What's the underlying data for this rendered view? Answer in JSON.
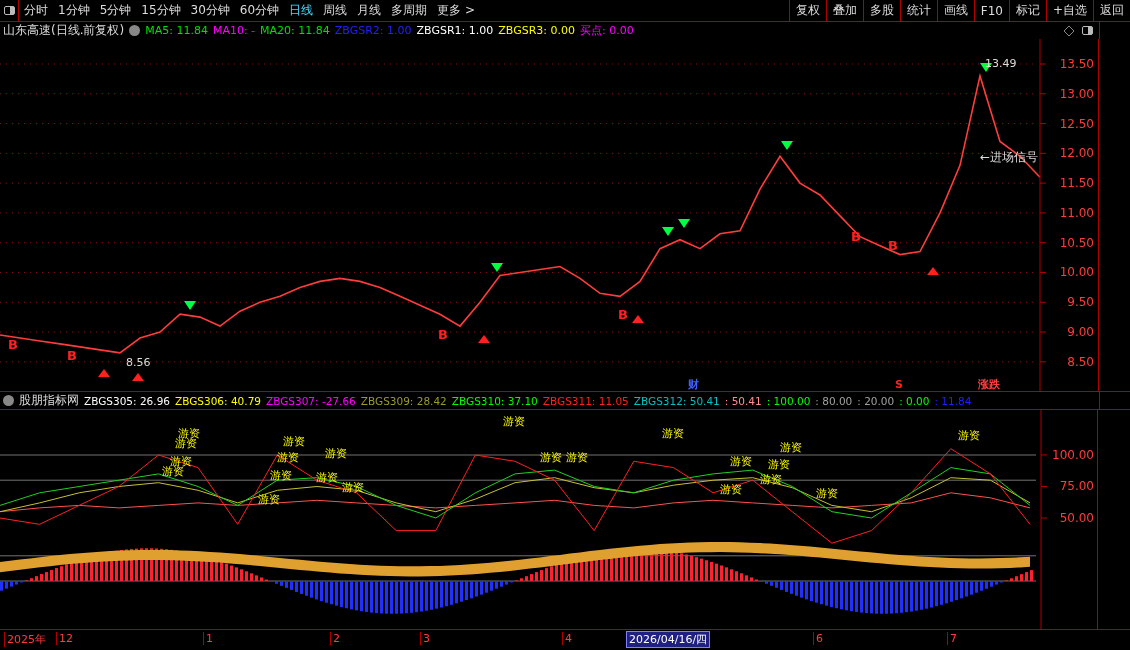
{
  "toolbar": {
    "periods": [
      {
        "label": "分时",
        "selected": false
      },
      {
        "label": "1分钟",
        "selected": false
      },
      {
        "label": "5分钟",
        "selected": false
      },
      {
        "label": "15分钟",
        "selected": false
      },
      {
        "label": "30分钟",
        "selected": false
      },
      {
        "label": "60分钟",
        "selected": false
      },
      {
        "label": "日线",
        "selected": true
      },
      {
        "label": "周线",
        "selected": false
      },
      {
        "label": "月线",
        "selected": false
      },
      {
        "label": "多周期",
        "selected": false
      },
      {
        "label": "更多 >",
        "selected": false
      }
    ],
    "buttons": [
      "复权",
      "叠加",
      "多股",
      "统计",
      "画线",
      "F10",
      "标记",
      "+自选",
      "返回"
    ]
  },
  "legend": {
    "title": "山东高速(日线.前复权)",
    "items": [
      {
        "text": "MA5: 11.84",
        "color": "#00e000"
      },
      {
        "text": "MA10: -",
        "color": "#ff00ff"
      },
      {
        "text": "MA20: 11.84",
        "color": "#00e000"
      },
      {
        "text": "ZBGSR2: 1.00",
        "color": "#2020ff"
      },
      {
        "text": "ZBGSR1: 1.00",
        "color": "#ffffff"
      },
      {
        "text": "ZBGSR3: 0.00",
        "color": "#ffff00"
      },
      {
        "text": "买点: 0.00",
        "color": "#ff00ff"
      }
    ]
  },
  "main_chart": {
    "chart_data": {
      "type": "line",
      "grid": true,
      "series": [
        {
          "color": "#ff3c3c",
          "values": [
            8.95,
            8.9,
            8.85,
            8.8,
            8.75,
            8.7,
            8.65,
            8.9,
            9.0,
            9.3,
            9.25,
            9.1,
            9.35,
            9.5,
            9.6,
            9.75,
            9.85,
            9.9,
            9.85,
            9.75,
            9.6,
            9.45,
            9.3,
            9.1,
            9.5,
            9.95,
            10.0,
            10.05,
            10.1,
            9.9,
            9.65,
            9.6,
            9.85,
            10.4,
            10.55,
            10.4,
            10.65,
            10.7,
            11.4,
            11.95,
            11.5,
            11.3,
            10.95,
            10.6,
            10.45,
            10.3,
            10.35,
            11.0,
            11.8,
            13.3,
            12.2,
            11.95,
            11.6
          ]
        }
      ],
      "ylim": [
        8.01,
        13.92
      ],
      "yticks": [
        {
          "value": 8.5,
          "label": "8.50"
        },
        {
          "value": 9,
          "label": "9.00"
        },
        {
          "value": 9.5,
          "label": "9.50"
        },
        {
          "value": 10,
          "label": "10.00"
        },
        {
          "value": 10.5,
          "label": "10.50"
        },
        {
          "value": 11,
          "label": "11.00"
        },
        {
          "value": 11.5,
          "label": "11.50"
        },
        {
          "value": 12,
          "label": "12.00"
        },
        {
          "value": 12.5,
          "label": "12.50"
        },
        {
          "value": 13,
          "label": "13.00"
        },
        {
          "value": 13.5,
          "label": "13.50"
        }
      ]
    },
    "price_labels": [
      "13.49",
      "8.56",
      "←进场信号"
    ],
    "signals": [
      "B",
      "B",
      "B",
      "B",
      "B",
      "B"
    ],
    "event_marks": [
      {
        "text": "财",
        "color": "#4060ff"
      },
      {
        "text": "S",
        "color": "#ff2020"
      },
      {
        "text": "涨跌",
        "color": "#ff4040"
      }
    ]
  },
  "indicator": {
    "title": "股朋指标网",
    "items": [
      {
        "text": "ZBGS305: 26.96",
        "color": "#ffffff"
      },
      {
        "text": "ZBGS306: 40.79",
        "color": "#ffff00"
      },
      {
        "text": "ZBGS307: -27.66",
        "color": "#ff00ff"
      },
      {
        "text": "ZBGS309: 28.42",
        "color": "#9a9a30"
      },
      {
        "text": "ZBGS310: 37.10",
        "color": "#00ff00"
      },
      {
        "text": "ZBGS311: 11.05",
        "color": "#ff2020"
      },
      {
        "text": "ZBGS312: 50.41",
        "color": "#00c0c0"
      },
      {
        "text": ": 50.41",
        "color": "#ff9090"
      },
      {
        "text": ": 100.00",
        "color": "#00ff00"
      },
      {
        "text": ": 80.00",
        "color": "#a0a0a0"
      },
      {
        "text": ": 20.00",
        "color": "#a0a0a0"
      },
      {
        "text": ": 0.00",
        "color": "#00ff00"
      },
      {
        "text": ": 11.84",
        "color": "#2020ff"
      }
    ],
    "chart_data": {
      "type": "line",
      "ylim": [
        -38.1,
        135.7
      ],
      "yticks": [
        {
          "value": 50,
          "label": "50.00"
        },
        {
          "value": 75,
          "label": "75.00"
        },
        {
          "value": 100,
          "label": "100.00"
        }
      ],
      "series": [
        {
          "color": "#ff5050",
          "values": [
            55,
            58,
            60,
            58,
            60,
            62,
            60,
            62,
            64,
            62,
            60,
            58,
            60,
            62,
            64,
            60,
            58,
            62,
            64,
            62,
            60,
            58,
            60,
            62,
            70,
            66,
            58
          ]
        },
        {
          "color": "#c8c030",
          "values": [
            55,
            62,
            70,
            75,
            78,
            72,
            62,
            72,
            75,
            72,
            62,
            55,
            65,
            78,
            82,
            74,
            70,
            76,
            80,
            82,
            74,
            60,
            55,
            66,
            82,
            80,
            62
          ]
        },
        {
          "color": "#20d020",
          "values": [
            60,
            70,
            75,
            80,
            85,
            75,
            60,
            80,
            82,
            75,
            60,
            50,
            70,
            85,
            88,
            75,
            70,
            80,
            85,
            88,
            75,
            55,
            50,
            70,
            90,
            85,
            60
          ]
        },
        {
          "color": "#ff2020",
          "values": [
            50,
            45,
            60,
            75,
            100,
            90,
            45,
            100,
            80,
            70,
            40,
            40,
            100,
            95,
            80,
            40,
            95,
            90,
            70,
            80,
            55,
            30,
            40,
            70,
            105,
            85,
            45
          ]
        }
      ]
    },
    "labels": [
      "游资",
      "游资",
      "游资",
      "游资",
      "游资",
      "游资",
      "游资",
      "游资",
      "游资",
      "游资",
      "游资",
      "游资",
      "游资",
      "游资",
      "游资",
      "游资",
      "游资",
      "游资",
      "游资",
      "游资",
      "游资",
      "游资"
    ]
  },
  "time_axis": [
    {
      "label": "2025年",
      "selected": false
    },
    {
      "label": "12",
      "selected": false
    },
    {
      "label": "1",
      "selected": false
    },
    {
      "label": "2",
      "selected": false
    },
    {
      "label": "3",
      "selected": false
    },
    {
      "label": "4",
      "selected": false
    },
    {
      "label": "2026/04/16/四",
      "selected": true
    },
    {
      "label": "6",
      "selected": false
    },
    {
      "label": "7",
      "selected": false
    }
  ]
}
